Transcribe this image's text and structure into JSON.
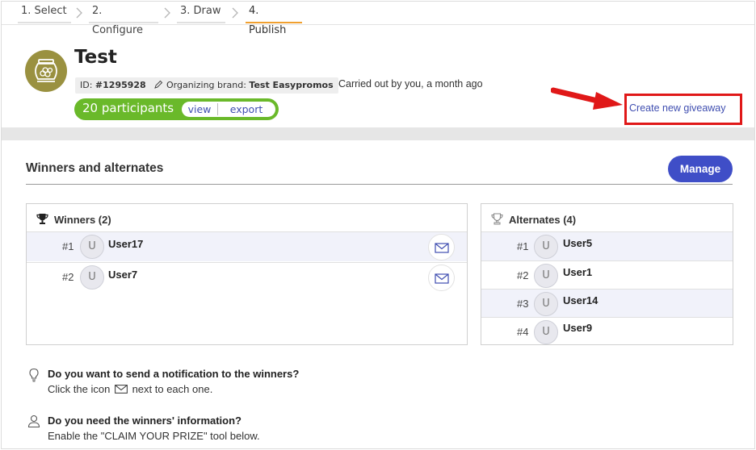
{
  "steps": [
    {
      "label": "1. Select"
    },
    {
      "label": "2. Configure"
    },
    {
      "label": "3. Draw"
    },
    {
      "label": "4. Publish"
    }
  ],
  "giveaway": {
    "title": "Test",
    "id_label": "ID: ",
    "id_value": "#1295928",
    "brand_label": "Organizing brand: ",
    "brand_value": "Test Easypromos",
    "carried_out": "Carried out by you, a month ago",
    "participants": "20 participants",
    "view_label": "view",
    "export_label": "export"
  },
  "create_link": "Create new giveaway",
  "section": {
    "title": "Winners and alternates",
    "manage_label": "Manage"
  },
  "winners": {
    "heading": "Winners (2)",
    "rows": [
      {
        "rank": "#1",
        "initial": "U",
        "name": "User17"
      },
      {
        "rank": "#2",
        "initial": "U",
        "name": "User7"
      }
    ]
  },
  "alternates": {
    "heading": "Alternates (4)",
    "rows": [
      {
        "rank": "#1",
        "initial": "U",
        "name": "User5"
      },
      {
        "rank": "#2",
        "initial": "U",
        "name": "User1"
      },
      {
        "rank": "#3",
        "initial": "U",
        "name": "User14"
      },
      {
        "rank": "#4",
        "initial": "U",
        "name": "User9"
      }
    ]
  },
  "tips": {
    "notify_q": "Do you want to send a notification to the winners?",
    "notify_a1": "Click the icon",
    "notify_a2": "next to each one.",
    "info_q": "Do you need the winners' information?",
    "info_a": "Enable the \"CLAIM YOUR PRIZE\" tool below."
  },
  "colors": {
    "accent": "#3f4ec7",
    "participants_green": "#6ab92a",
    "highlight_red": "#e01818",
    "active_step": "#f0a030"
  },
  "icons": {
    "steps_separator": "chevron-right-icon",
    "brand": "pencil-icon",
    "winners": "trophy-icon",
    "alternates": "trophy-outline-icon",
    "mail": "mail-icon",
    "notify": "lightbulb-icon",
    "info": "user-icon"
  }
}
